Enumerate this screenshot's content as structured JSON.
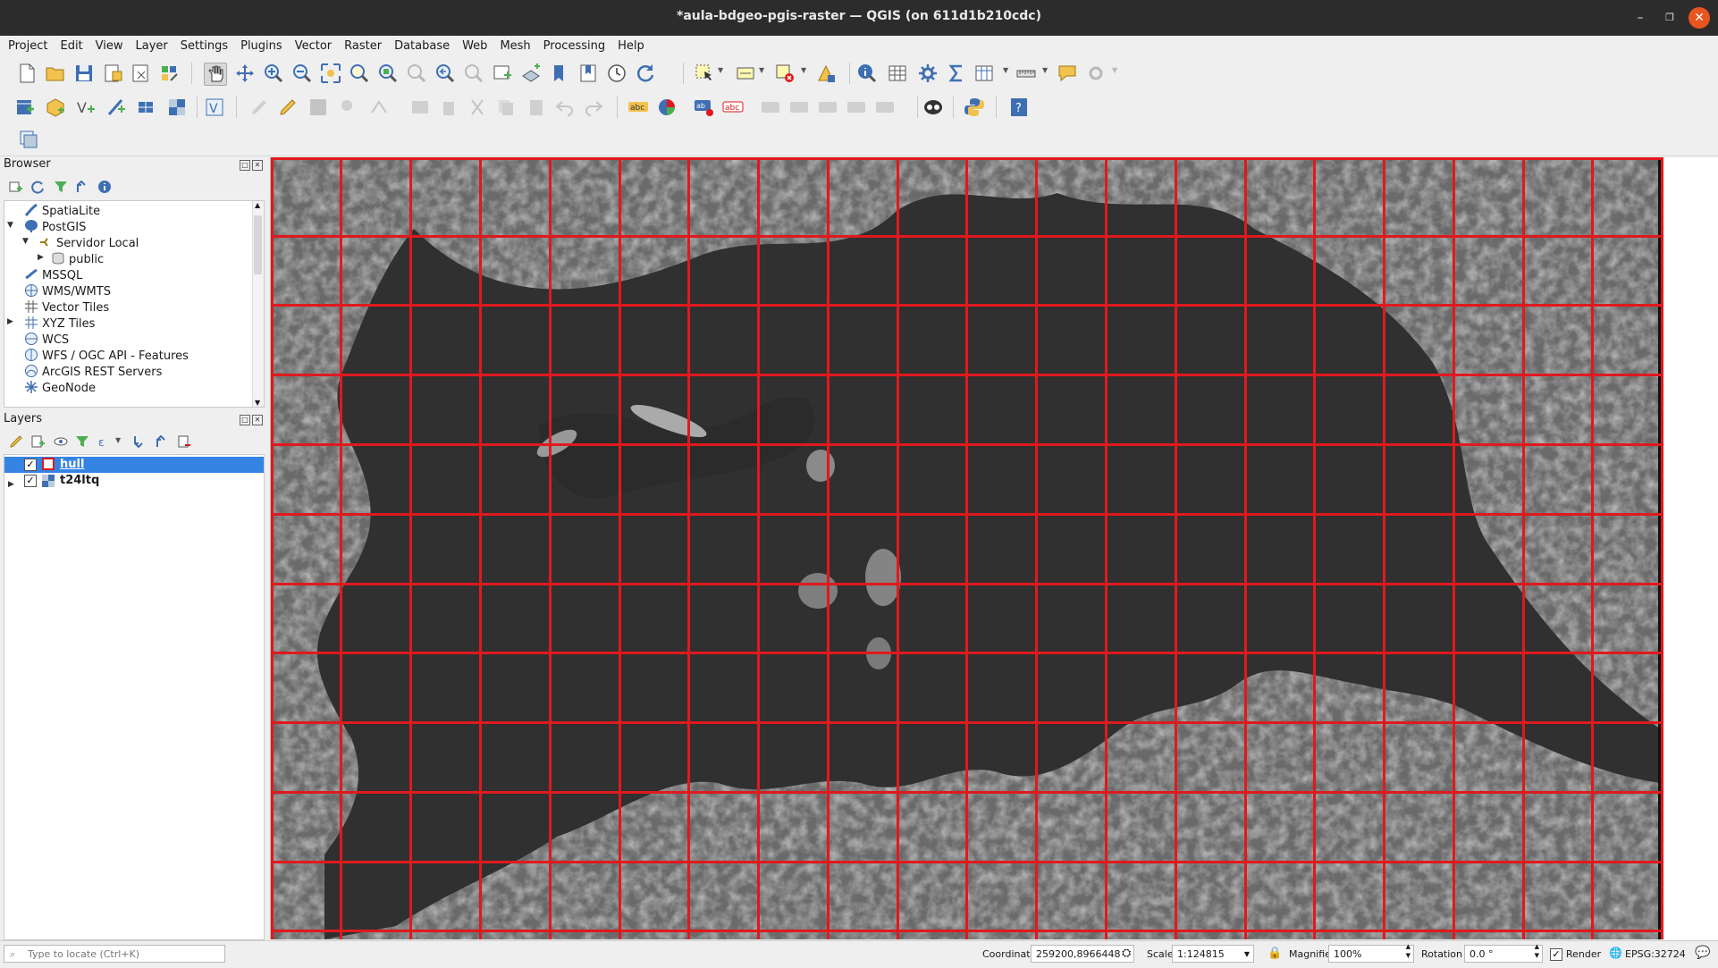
{
  "window": {
    "title": "*aula-bdgeo-pgis-raster — QGIS (on 611d1b210cdc)"
  },
  "menu": [
    "Project",
    "Edit",
    "View",
    "Layer",
    "Settings",
    "Plugins",
    "Vector",
    "Raster",
    "Database",
    "Web",
    "Mesh",
    "Processing",
    "Help"
  ],
  "browser": {
    "title": "Browser",
    "items": [
      {
        "label": "SpatiaLite",
        "icon": "spatialite-icon"
      },
      {
        "label": "PostGIS",
        "icon": "postgis-icon"
      },
      {
        "label": "Servidor Local",
        "icon": "connection-icon"
      },
      {
        "label": "public",
        "icon": "schema-icon"
      },
      {
        "label": "MSSQL",
        "icon": "mssql-icon"
      },
      {
        "label": "WMS/WMTS",
        "icon": "wms-icon"
      },
      {
        "label": "Vector Tiles",
        "icon": "vector-tiles-icon"
      },
      {
        "label": "XYZ Tiles",
        "icon": "xyz-tiles-icon"
      },
      {
        "label": "WCS",
        "icon": "wcs-icon"
      },
      {
        "label": "WFS / OGC API - Features",
        "icon": "wfs-icon"
      },
      {
        "label": "ArcGIS REST Servers",
        "icon": "arcgis-icon"
      },
      {
        "label": "GeoNode",
        "icon": "geonode-icon"
      }
    ]
  },
  "layers": {
    "title": "Layers",
    "items": [
      {
        "label": "hull",
        "checked": true,
        "selected": true
      },
      {
        "label": "t24ltq",
        "checked": true,
        "selected": false
      }
    ]
  },
  "status": {
    "locate_placeholder": "Type to locate (Ctrl+K)",
    "coordinate_label": "Coordinate",
    "coordinate_value": "259200,8966448",
    "scale_label": "Scale",
    "scale_value": "1:124815",
    "magnifier_label": "Magnifier",
    "magnifier_value": "100%",
    "rotation_label": "Rotation",
    "rotation_value": "0.0 °",
    "render_label": "Render",
    "crs_label": "EPSG:32724"
  },
  "colors": {
    "accent": "#3584e4",
    "grid": "#e0191e",
    "close": "#e95420"
  }
}
